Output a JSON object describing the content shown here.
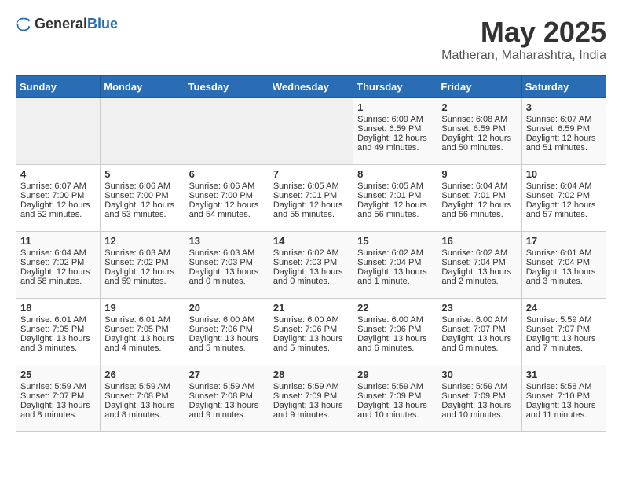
{
  "header": {
    "logo_general": "General",
    "logo_blue": "Blue",
    "title": "May 2025",
    "subtitle": "Matheran, Maharashtra, India"
  },
  "weekdays": [
    "Sunday",
    "Monday",
    "Tuesday",
    "Wednesday",
    "Thursday",
    "Friday",
    "Saturday"
  ],
  "weeks": [
    [
      {
        "day": "",
        "empty": true
      },
      {
        "day": "",
        "empty": true
      },
      {
        "day": "",
        "empty": true
      },
      {
        "day": "",
        "empty": true
      },
      {
        "day": "1",
        "sunrise": "Sunrise: 6:09 AM",
        "sunset": "Sunset: 6:59 PM",
        "daylight": "Daylight: 12 hours and 49 minutes."
      },
      {
        "day": "2",
        "sunrise": "Sunrise: 6:08 AM",
        "sunset": "Sunset: 6:59 PM",
        "daylight": "Daylight: 12 hours and 50 minutes."
      },
      {
        "day": "3",
        "sunrise": "Sunrise: 6:07 AM",
        "sunset": "Sunset: 6:59 PM",
        "daylight": "Daylight: 12 hours and 51 minutes."
      }
    ],
    [
      {
        "day": "4",
        "sunrise": "Sunrise: 6:07 AM",
        "sunset": "Sunset: 7:00 PM",
        "daylight": "Daylight: 12 hours and 52 minutes."
      },
      {
        "day": "5",
        "sunrise": "Sunrise: 6:06 AM",
        "sunset": "Sunset: 7:00 PM",
        "daylight": "Daylight: 12 hours and 53 minutes."
      },
      {
        "day": "6",
        "sunrise": "Sunrise: 6:06 AM",
        "sunset": "Sunset: 7:00 PM",
        "daylight": "Daylight: 12 hours and 54 minutes."
      },
      {
        "day": "7",
        "sunrise": "Sunrise: 6:05 AM",
        "sunset": "Sunset: 7:01 PM",
        "daylight": "Daylight: 12 hours and 55 minutes."
      },
      {
        "day": "8",
        "sunrise": "Sunrise: 6:05 AM",
        "sunset": "Sunset: 7:01 PM",
        "daylight": "Daylight: 12 hours and 56 minutes."
      },
      {
        "day": "9",
        "sunrise": "Sunrise: 6:04 AM",
        "sunset": "Sunset: 7:01 PM",
        "daylight": "Daylight: 12 hours and 56 minutes."
      },
      {
        "day": "10",
        "sunrise": "Sunrise: 6:04 AM",
        "sunset": "Sunset: 7:02 PM",
        "daylight": "Daylight: 12 hours and 57 minutes."
      }
    ],
    [
      {
        "day": "11",
        "sunrise": "Sunrise: 6:04 AM",
        "sunset": "Sunset: 7:02 PM",
        "daylight": "Daylight: 12 hours and 58 minutes."
      },
      {
        "day": "12",
        "sunrise": "Sunrise: 6:03 AM",
        "sunset": "Sunset: 7:02 PM",
        "daylight": "Daylight: 12 hours and 59 minutes."
      },
      {
        "day": "13",
        "sunrise": "Sunrise: 6:03 AM",
        "sunset": "Sunset: 7:03 PM",
        "daylight": "Daylight: 13 hours and 0 minutes."
      },
      {
        "day": "14",
        "sunrise": "Sunrise: 6:02 AM",
        "sunset": "Sunset: 7:03 PM",
        "daylight": "Daylight: 13 hours and 0 minutes."
      },
      {
        "day": "15",
        "sunrise": "Sunrise: 6:02 AM",
        "sunset": "Sunset: 7:04 PM",
        "daylight": "Daylight: 13 hours and 1 minute."
      },
      {
        "day": "16",
        "sunrise": "Sunrise: 6:02 AM",
        "sunset": "Sunset: 7:04 PM",
        "daylight": "Daylight: 13 hours and 2 minutes."
      },
      {
        "day": "17",
        "sunrise": "Sunrise: 6:01 AM",
        "sunset": "Sunset: 7:04 PM",
        "daylight": "Daylight: 13 hours and 3 minutes."
      }
    ],
    [
      {
        "day": "18",
        "sunrise": "Sunrise: 6:01 AM",
        "sunset": "Sunset: 7:05 PM",
        "daylight": "Daylight: 13 hours and 3 minutes."
      },
      {
        "day": "19",
        "sunrise": "Sunrise: 6:01 AM",
        "sunset": "Sunset: 7:05 PM",
        "daylight": "Daylight: 13 hours and 4 minutes."
      },
      {
        "day": "20",
        "sunrise": "Sunrise: 6:00 AM",
        "sunset": "Sunset: 7:06 PM",
        "daylight": "Daylight: 13 hours and 5 minutes."
      },
      {
        "day": "21",
        "sunrise": "Sunrise: 6:00 AM",
        "sunset": "Sunset: 7:06 PM",
        "daylight": "Daylight: 13 hours and 5 minutes."
      },
      {
        "day": "22",
        "sunrise": "Sunrise: 6:00 AM",
        "sunset": "Sunset: 7:06 PM",
        "daylight": "Daylight: 13 hours and 6 minutes."
      },
      {
        "day": "23",
        "sunrise": "Sunrise: 6:00 AM",
        "sunset": "Sunset: 7:07 PM",
        "daylight": "Daylight: 13 hours and 6 minutes."
      },
      {
        "day": "24",
        "sunrise": "Sunrise: 5:59 AM",
        "sunset": "Sunset: 7:07 PM",
        "daylight": "Daylight: 13 hours and 7 minutes."
      }
    ],
    [
      {
        "day": "25",
        "sunrise": "Sunrise: 5:59 AM",
        "sunset": "Sunset: 7:07 PM",
        "daylight": "Daylight: 13 hours and 8 minutes."
      },
      {
        "day": "26",
        "sunrise": "Sunrise: 5:59 AM",
        "sunset": "Sunset: 7:08 PM",
        "daylight": "Daylight: 13 hours and 8 minutes."
      },
      {
        "day": "27",
        "sunrise": "Sunrise: 5:59 AM",
        "sunset": "Sunset: 7:08 PM",
        "daylight": "Daylight: 13 hours and 9 minutes."
      },
      {
        "day": "28",
        "sunrise": "Sunrise: 5:59 AM",
        "sunset": "Sunset: 7:09 PM",
        "daylight": "Daylight: 13 hours and 9 minutes."
      },
      {
        "day": "29",
        "sunrise": "Sunrise: 5:59 AM",
        "sunset": "Sunset: 7:09 PM",
        "daylight": "Daylight: 13 hours and 10 minutes."
      },
      {
        "day": "30",
        "sunrise": "Sunrise: 5:59 AM",
        "sunset": "Sunset: 7:09 PM",
        "daylight": "Daylight: 13 hours and 10 minutes."
      },
      {
        "day": "31",
        "sunrise": "Sunrise: 5:58 AM",
        "sunset": "Sunset: 7:10 PM",
        "daylight": "Daylight: 13 hours and 11 minutes."
      }
    ]
  ]
}
